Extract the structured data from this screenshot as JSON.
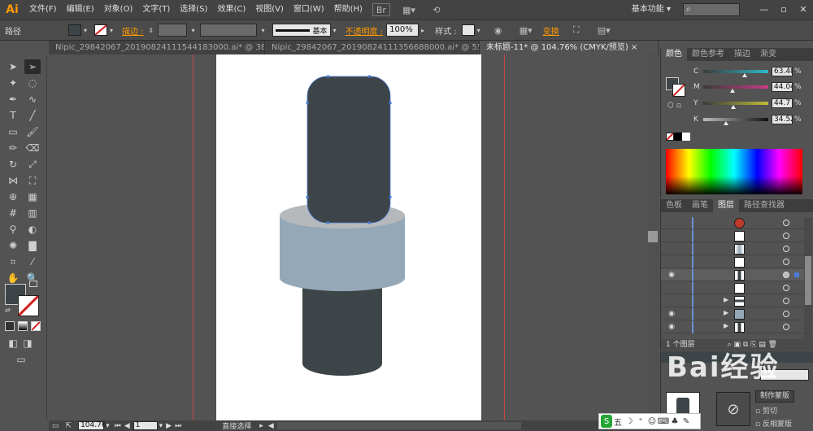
{
  "menubar": {
    "logo": "Ai",
    "items": [
      "文件(F)",
      "编辑(E)",
      "对象(O)",
      "文字(T)",
      "选择(S)",
      "效果(C)",
      "视图(V)",
      "窗口(W)",
      "帮助(H)"
    ],
    "workspace": "基本功能",
    "workspace_arrow": "▾",
    "icons": [
      "bridge-icon",
      "arrange-documents-icon",
      "gpu-icon"
    ],
    "window_buttons": [
      "—",
      "▫",
      "✕"
    ]
  },
  "controlbar": {
    "selection_label": "路径",
    "stroke_label": "描边 :",
    "stroke_style": "基本",
    "opacity_label": "不透明度 :",
    "opacity_value": "100%",
    "style_label": "样式 :",
    "transform_link": "变换"
  },
  "tabs": [
    {
      "label": "Nipic_29842067_20190824111544183000.ai* @ 38...",
      "close": "×"
    },
    {
      "label": "Nipic_29842067_20190824111356688000.ai* @ 55...",
      "close": "×"
    },
    {
      "label": "未标题-11* @ 104.76% (CMYK/预览)",
      "close": "×"
    }
  ],
  "statusbar": {
    "zoom": "104.76",
    "artboard": "1",
    "tool_name": "直接选择"
  },
  "color_panel": {
    "tabs": [
      "颜色",
      "颜色参考",
      "描边",
      "渐变"
    ],
    "sliders": [
      {
        "name": "C",
        "value": "63.48",
        "unit": "%",
        "pos": 0.63,
        "color": "#2fb8c6"
      },
      {
        "name": "M",
        "value": "44.04",
        "unit": "%",
        "pos": 0.44,
        "color": "#c93b86"
      },
      {
        "name": "Y",
        "value": "44.7",
        "unit": "%",
        "pos": 0.45,
        "color": "#bdbd3a"
      },
      {
        "name": "K",
        "value": "34.52",
        "unit": "%",
        "pos": 0.35,
        "color": "#111111"
      }
    ],
    "fill_color": "#3d4548"
  },
  "layers_panel": {
    "tabs": [
      "色板",
      "画笔",
      "图层",
      "路径查找器"
    ],
    "footer_text": "1 个图层"
  },
  "bottom_panel": {
    "btn_mask": "制作蒙版",
    "btn_clip": "剪切",
    "btn_invert": "反相蒙版"
  },
  "ime": {
    "items": [
      "五",
      "☽",
      "⁺",
      "☺",
      "⌨",
      "♣",
      "✎"
    ]
  },
  "watermark": "Bai经验",
  "artwork": {
    "cap_color": "#3d4548",
    "ring_color": "#95a8b8",
    "ring_top_color": "#b5b9bb",
    "base_color": "#3d4548"
  }
}
